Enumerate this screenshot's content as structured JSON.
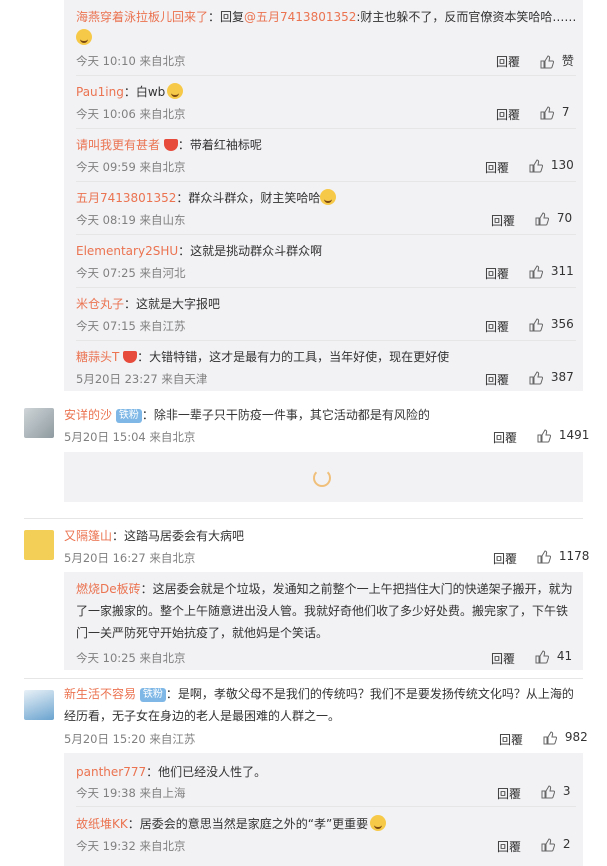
{
  "labels": {
    "reply": "回覆"
  },
  "sub_top": [
    {
      "name": "海燕穿着泳拉板儿回来了",
      "text_prefix": "：回复",
      "mention": "@五月7413801352",
      "text": ":财主也躲不了，反而官僚资本笑哈哈……",
      "meta": "今天 10:10 来自北京",
      "likes": "赞"
    },
    {
      "name": "Pau1ing",
      "text": "：白wb",
      "meta": "今天 10:06 来自北京",
      "likes": "7"
    },
    {
      "name": "请叫我更有甚者",
      "text": "：带着红袖标呢",
      "meta": "今天 09:59 来自北京",
      "likes": "130"
    },
    {
      "name": "五月7413801352",
      "text": "：群众斗群众，财主笑哈哈",
      "meta": "今天 08:19 来自山东",
      "likes": "70"
    },
    {
      "name": "Elementary2SHU",
      "text": "：这就是挑动群众斗群众啊",
      "meta": "今天 07:25 来自河北",
      "likes": "311"
    },
    {
      "name": "米仓丸子",
      "text": "：这就是大字报吧",
      "meta": "今天 07:15 来自江苏",
      "likes": "356"
    },
    {
      "name": "糖蒜头T",
      "text": "：大错特错，这才是最有力的工具，当年好使，现在更好使",
      "meta": "5月20日 23:27 来自天津",
      "likes": "387"
    }
  ],
  "comment1": {
    "name": "安详的沙",
    "badge": "铁粉",
    "text": "：除非一辈子只干防疫一件事，其它活动都是有风险的",
    "meta": "5月20日 15:04 来自北京",
    "likes": "1491"
  },
  "comment2": {
    "name": "又隔篷山",
    "text": "：这踏马居委会有大病吧",
    "meta": "5月20日 16:27 来自北京",
    "likes": "1178"
  },
  "comment2_reply": {
    "name": "燃烧De板砖",
    "line1": "：这居委会就是个垃圾，发通知之前整个一上午把挡住大门的快递架子搬开，就为",
    "line2": "了一家搬家的。整个上午随意进出没人管。我就好奇他们收了多少好处费。搬完家了，下午铁",
    "line3": "门一关严防死守开始抗疫了，就他妈是个笑话。",
    "meta": "今天 10:25 来自北京",
    "likes": "41"
  },
  "comment3": {
    "name": "新生活不容易",
    "badge": "铁粉",
    "line1": "：是啊，孝敬父母不是我们的传统吗？我们不是要发扬传统文化吗？从上海的",
    "line2": "经历看，无子女在身边的老人是最困难的人群之一。",
    "meta": "5月20日 15:20 来自江苏",
    "likes": "982"
  },
  "comment3_replies": [
    {
      "name": "panther777",
      "text": "：他们已经没人性了。",
      "meta": "今天 19:38 来自上海",
      "likes": "3"
    },
    {
      "name": "故纸堆KK",
      "text": "：居委会的意思当然是家庭之外的“孝”更重要",
      "meta": "今天 19:32 来自北京",
      "likes": "2"
    }
  ]
}
